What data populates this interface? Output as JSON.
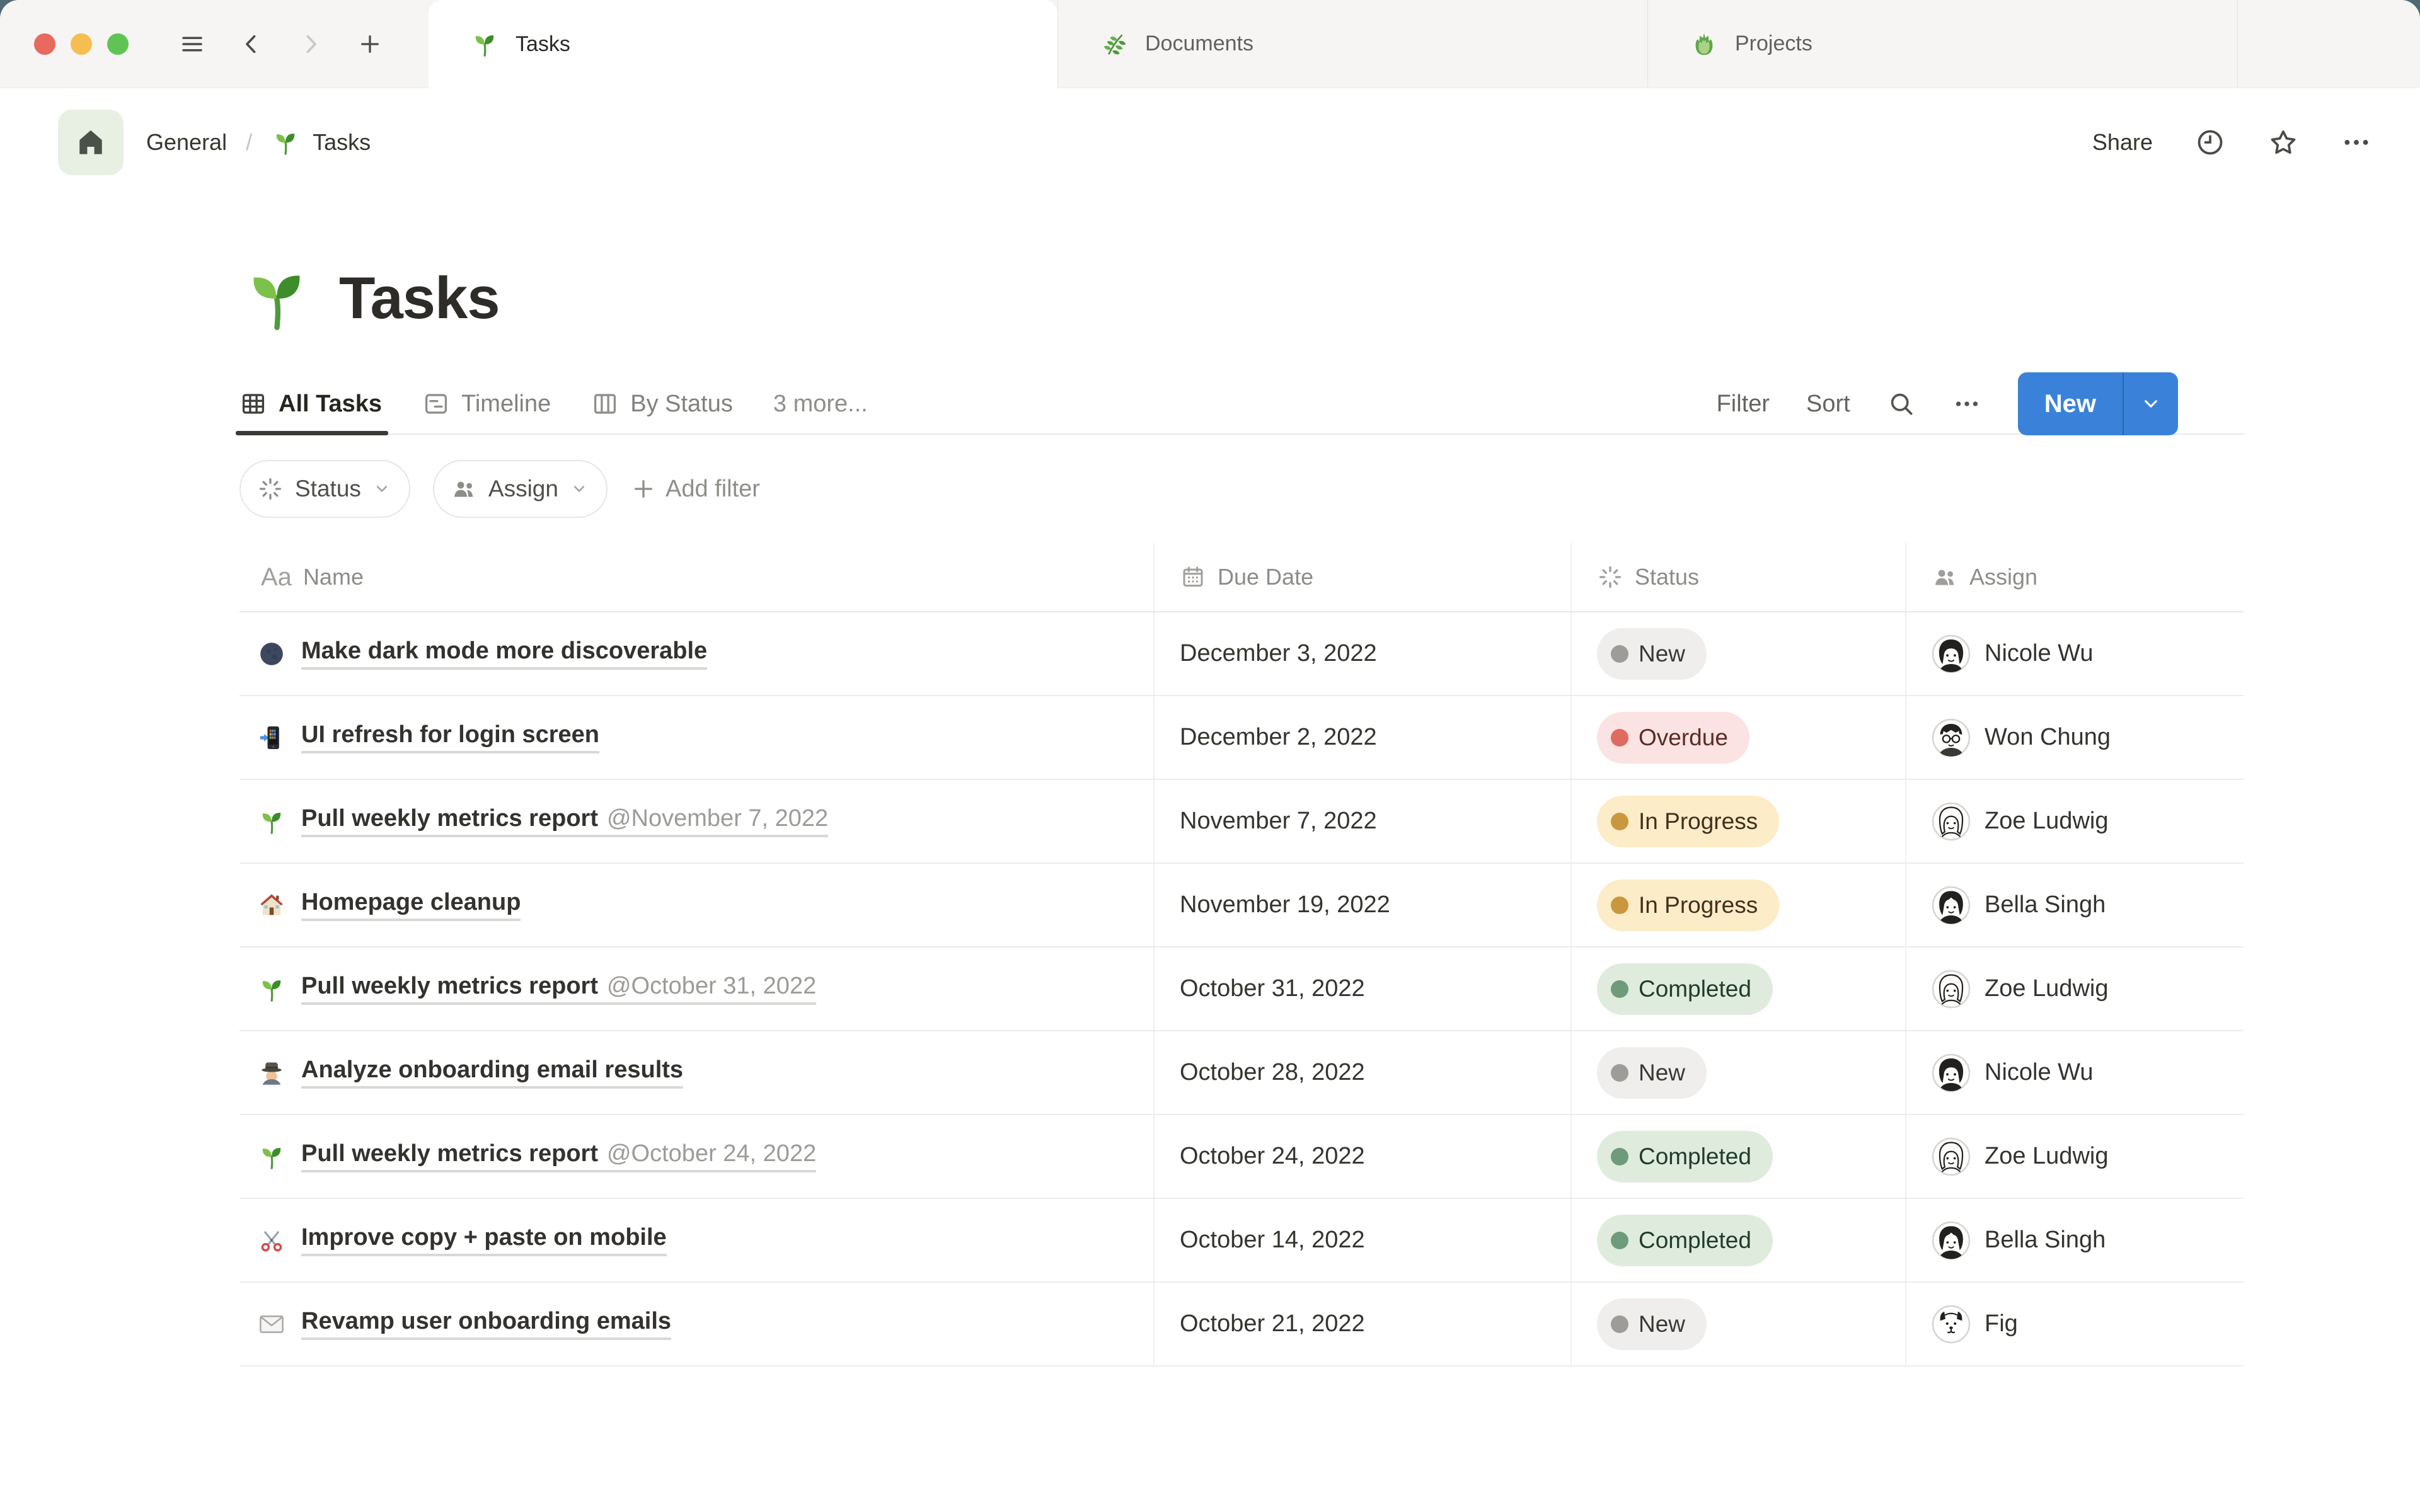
{
  "chrome": {
    "traffic_light_colors": {
      "close": "#e8695e",
      "minimize": "#f6be50",
      "zoom": "#5fc454"
    },
    "nav_icons": [
      "hamburger-icon",
      "back-icon",
      "forward-icon",
      "plus-icon"
    ],
    "tabs": [
      {
        "label": "Tasks",
        "icon": "sprout-icon",
        "active": true
      },
      {
        "label": "Documents",
        "icon": "herb-icon",
        "active": false
      },
      {
        "label": "Projects",
        "icon": "leafy-icon",
        "active": false
      }
    ]
  },
  "topbar": {
    "breadcrumb": {
      "home_icon": "home-icon",
      "workspace": "General",
      "separator": "/",
      "page_icon": "sprout-icon",
      "page": "Tasks"
    },
    "actions": {
      "share": "Share",
      "icons": [
        "clock-icon",
        "star-icon",
        "ellipsis-icon"
      ]
    }
  },
  "page": {
    "icon": "sprout-icon",
    "title": "Tasks"
  },
  "views": {
    "tabs": [
      {
        "label": "All Tasks",
        "icon": "table-view-icon",
        "active": true
      },
      {
        "label": "Timeline",
        "icon": "timeline-view-icon",
        "active": false
      },
      {
        "label": "By Status",
        "icon": "board-view-icon",
        "active": false
      }
    ],
    "more_label": "3 more...",
    "controls": {
      "filter": "Filter",
      "sort": "Sort",
      "search_icon": "search-icon",
      "more_icon": "ellipsis-icon"
    },
    "new_button": {
      "label": "New",
      "color": "#3a82d9",
      "chevron_icon": "chevron-down-icon"
    }
  },
  "filter_bar": {
    "chips": [
      {
        "label": "Status",
        "icon": "status-icon",
        "chevron": "chevron-down-icon"
      },
      {
        "label": "Assign",
        "icon": "people-icon",
        "chevron": "chevron-down-icon"
      }
    ],
    "add_filter": {
      "label": "Add filter",
      "icon": "plus-icon"
    }
  },
  "table": {
    "columns": [
      {
        "label": "Name",
        "icon": "text-type-icon",
        "icon_text": "Aa"
      },
      {
        "label": "Due Date",
        "icon": "calendar-icon"
      },
      {
        "label": "Status",
        "icon": "status-icon"
      },
      {
        "label": "Assign",
        "icon": "people-icon"
      }
    ],
    "rows": [
      {
        "icon": "moon-icon",
        "name": "Make dark mode more discoverable",
        "mention": "",
        "due": "December 3, 2022",
        "status": "New",
        "status_key": "new",
        "assignee": "Nicole Wu",
        "avatar": "avatar-nicole"
      },
      {
        "icon": "phone-icon",
        "name": "UI refresh for login screen",
        "mention": "",
        "due": "December 2, 2022",
        "status": "Overdue",
        "status_key": "overdue",
        "assignee": "Won Chung",
        "avatar": "avatar-won"
      },
      {
        "icon": "sprout-icon",
        "name": "Pull weekly metrics report",
        "mention": "@November 7, 2022",
        "due": "November 7, 2022",
        "status": "In Progress",
        "status_key": "in_progress",
        "assignee": "Zoe Ludwig",
        "avatar": "avatar-zoe"
      },
      {
        "icon": "house-icon",
        "name": "Homepage cleanup",
        "mention": "",
        "due": "November 19, 2022",
        "status": "In Progress",
        "status_key": "in_progress",
        "assignee": "Bella Singh",
        "avatar": "avatar-bella"
      },
      {
        "icon": "sprout-icon",
        "name": "Pull weekly metrics report",
        "mention": "@October 31, 2022",
        "due": "October 31, 2022",
        "status": "Completed",
        "status_key": "completed",
        "assignee": "Zoe Ludwig",
        "avatar": "avatar-zoe"
      },
      {
        "icon": "detective-icon",
        "name": "Analyze onboarding email results",
        "mention": "",
        "due": "October 28, 2022",
        "status": "New",
        "status_key": "new",
        "assignee": "Nicole Wu",
        "avatar": "avatar-nicole"
      },
      {
        "icon": "sprout-icon",
        "name": "Pull weekly metrics report",
        "mention": "@October 24, 2022",
        "due": "October 24, 2022",
        "status": "Completed",
        "status_key": "completed",
        "assignee": "Zoe Ludwig",
        "avatar": "avatar-zoe"
      },
      {
        "icon": "scissors-icon",
        "name": "Improve copy + paste on mobile",
        "mention": "",
        "due": "October 14, 2022",
        "status": "Completed",
        "status_key": "completed",
        "assignee": "Bella Singh",
        "avatar": "avatar-bella"
      },
      {
        "icon": "envelope-icon",
        "name": "Revamp user onboarding emails",
        "mention": "",
        "due": "October 21, 2022",
        "status": "New",
        "status_key": "new",
        "assignee": "Fig",
        "avatar": "avatar-fig"
      }
    ]
  },
  "status_styles": {
    "new": {
      "bg": "#efeeec",
      "dot": "#9d9c99",
      "text": "#3a3935"
    },
    "overdue": {
      "bg": "#fae3e2",
      "dot": "#df6a62",
      "text": "#5d2b26"
    },
    "in_progress": {
      "bg": "#fcecc7",
      "dot": "#c9973e",
      "text": "#41301e"
    },
    "completed": {
      "bg": "#dfecdd",
      "dot": "#6e9b7a",
      "text": "#213c2b"
    }
  }
}
